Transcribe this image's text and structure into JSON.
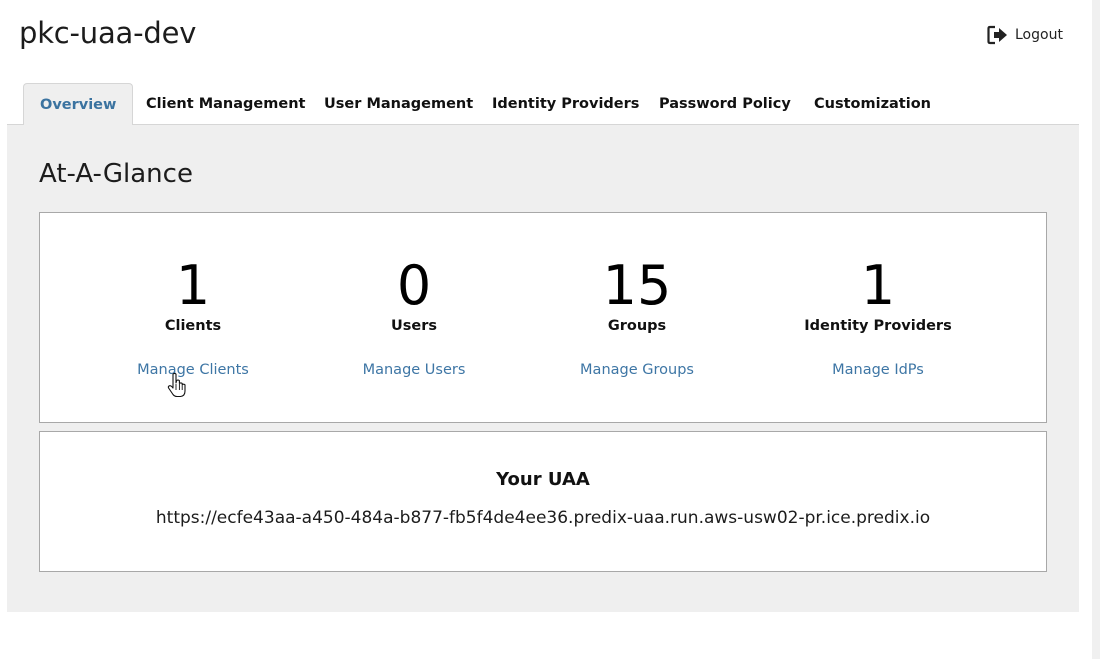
{
  "app": {
    "title": "pkc-uaa-dev"
  },
  "header": {
    "logout_label": "Logout"
  },
  "tabs": [
    {
      "label": "Overview",
      "active": true
    },
    {
      "label": "Client Management"
    },
    {
      "label": "User Management"
    },
    {
      "label": "Identity Providers"
    },
    {
      "label": "Password Policy"
    },
    {
      "label": "Customization"
    }
  ],
  "overview": {
    "title": "At-A-Glance",
    "stats": [
      {
        "count": "1",
        "label": "Clients",
        "link": "Manage Clients"
      },
      {
        "count": "0",
        "label": "Users",
        "link": "Manage Users"
      },
      {
        "count": "15",
        "label": "Groups",
        "link": "Manage Groups"
      },
      {
        "count": "1",
        "label": "Identity Providers",
        "link": "Manage IdPs"
      }
    ],
    "uaa": {
      "title": "Your UAA",
      "url": "https://ecfe43aa-a450-484a-b877-fb5f4de4ee36.predix-uaa.run.aws-usw02-pr.ice.predix.io"
    }
  },
  "colors": {
    "link": "#3e76a5",
    "active_tab": "#3b73a0",
    "panel_bg": "#efefef"
  },
  "icons": {
    "logout": "sign-out-icon"
  }
}
